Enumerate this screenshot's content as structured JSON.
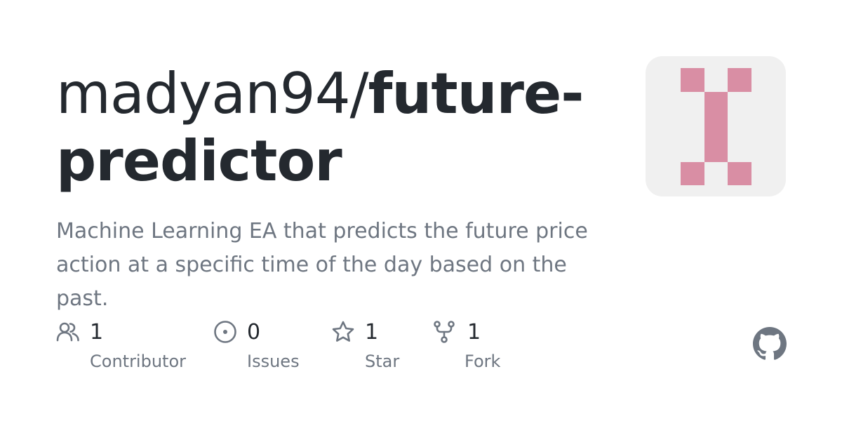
{
  "repo": {
    "owner": "madyan94/",
    "name": "future-predictor",
    "description": "Machine Learning EA that predicts the future price action at a specific time of the day based on the past."
  },
  "avatar": {
    "icon": "identicon",
    "background": "#f0f0f0",
    "color": "#d98ea4"
  },
  "stats": [
    {
      "icon": "people-icon",
      "count": "1",
      "label": "Contributor"
    },
    {
      "icon": "issue-opened-icon",
      "count": "0",
      "label": "Issues"
    },
    {
      "icon": "star-icon",
      "count": "1",
      "label": "Star"
    },
    {
      "icon": "repo-forked-icon",
      "count": "1",
      "label": "Fork"
    }
  ],
  "brand": {
    "icon": "github-mark-icon",
    "color": "#6e7681"
  },
  "colors": {
    "text": "#24292f",
    "muted": "#6e7681"
  }
}
